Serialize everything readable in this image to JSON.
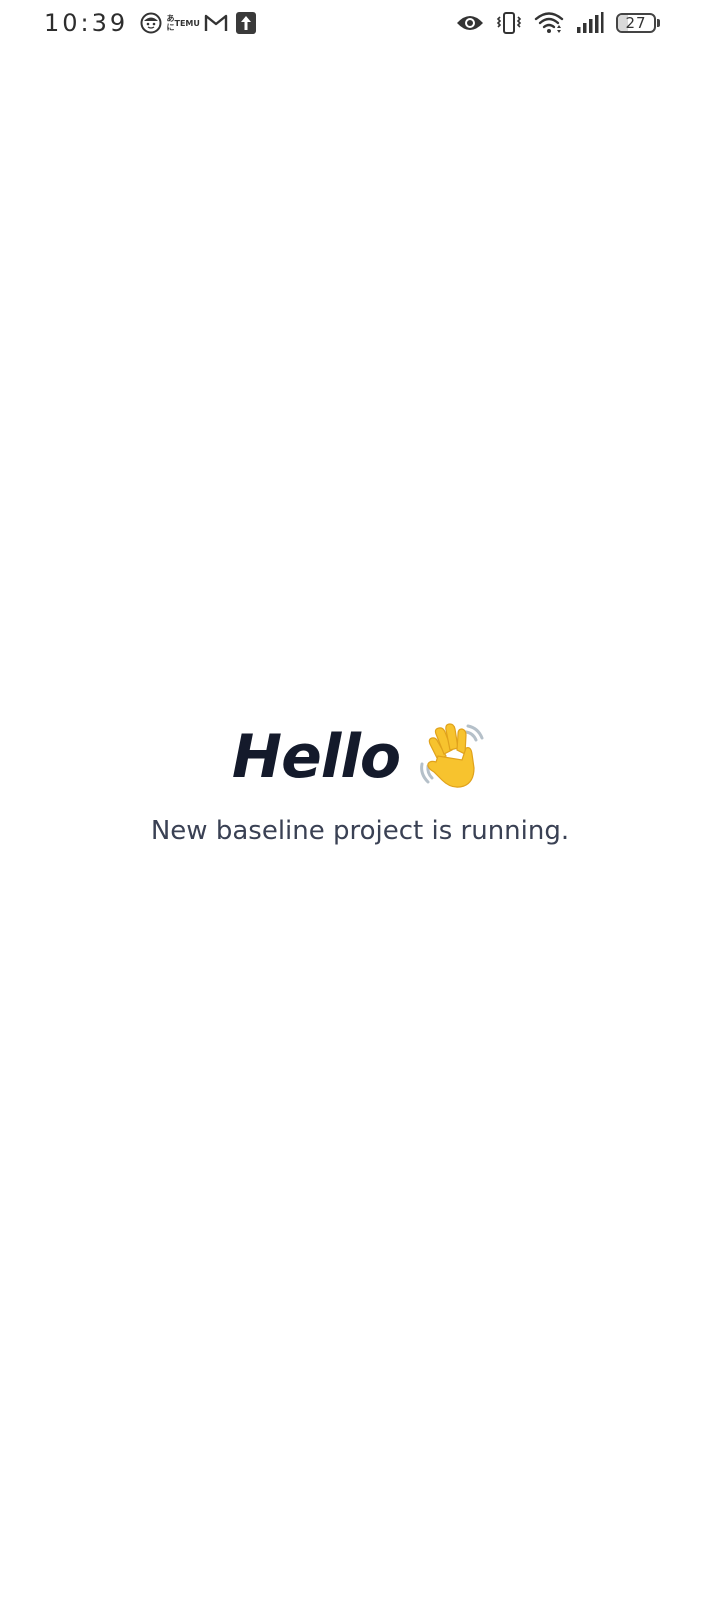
{
  "status_bar": {
    "time": "10:39",
    "temu_label_top": "あに",
    "temu_label_bottom": "TEMU",
    "battery_level": "27",
    "battery_fraction": 0.27,
    "left_icons": [
      "face-icon",
      "temu-icon",
      "gmail-icon",
      "upload-icon"
    ],
    "right_icons": [
      "eye-icon",
      "vibrate-icon",
      "wifi-icon",
      "signal-icon",
      "battery-icon"
    ]
  },
  "main": {
    "title": "Hello",
    "title_emoji": "waving-hand-icon",
    "subtitle": "New baseline project is running."
  },
  "colors": {
    "background": "#ffffff",
    "title": "#141a2b",
    "subtitle": "#3a4154",
    "emoji_yellow": "#f7c32e"
  }
}
